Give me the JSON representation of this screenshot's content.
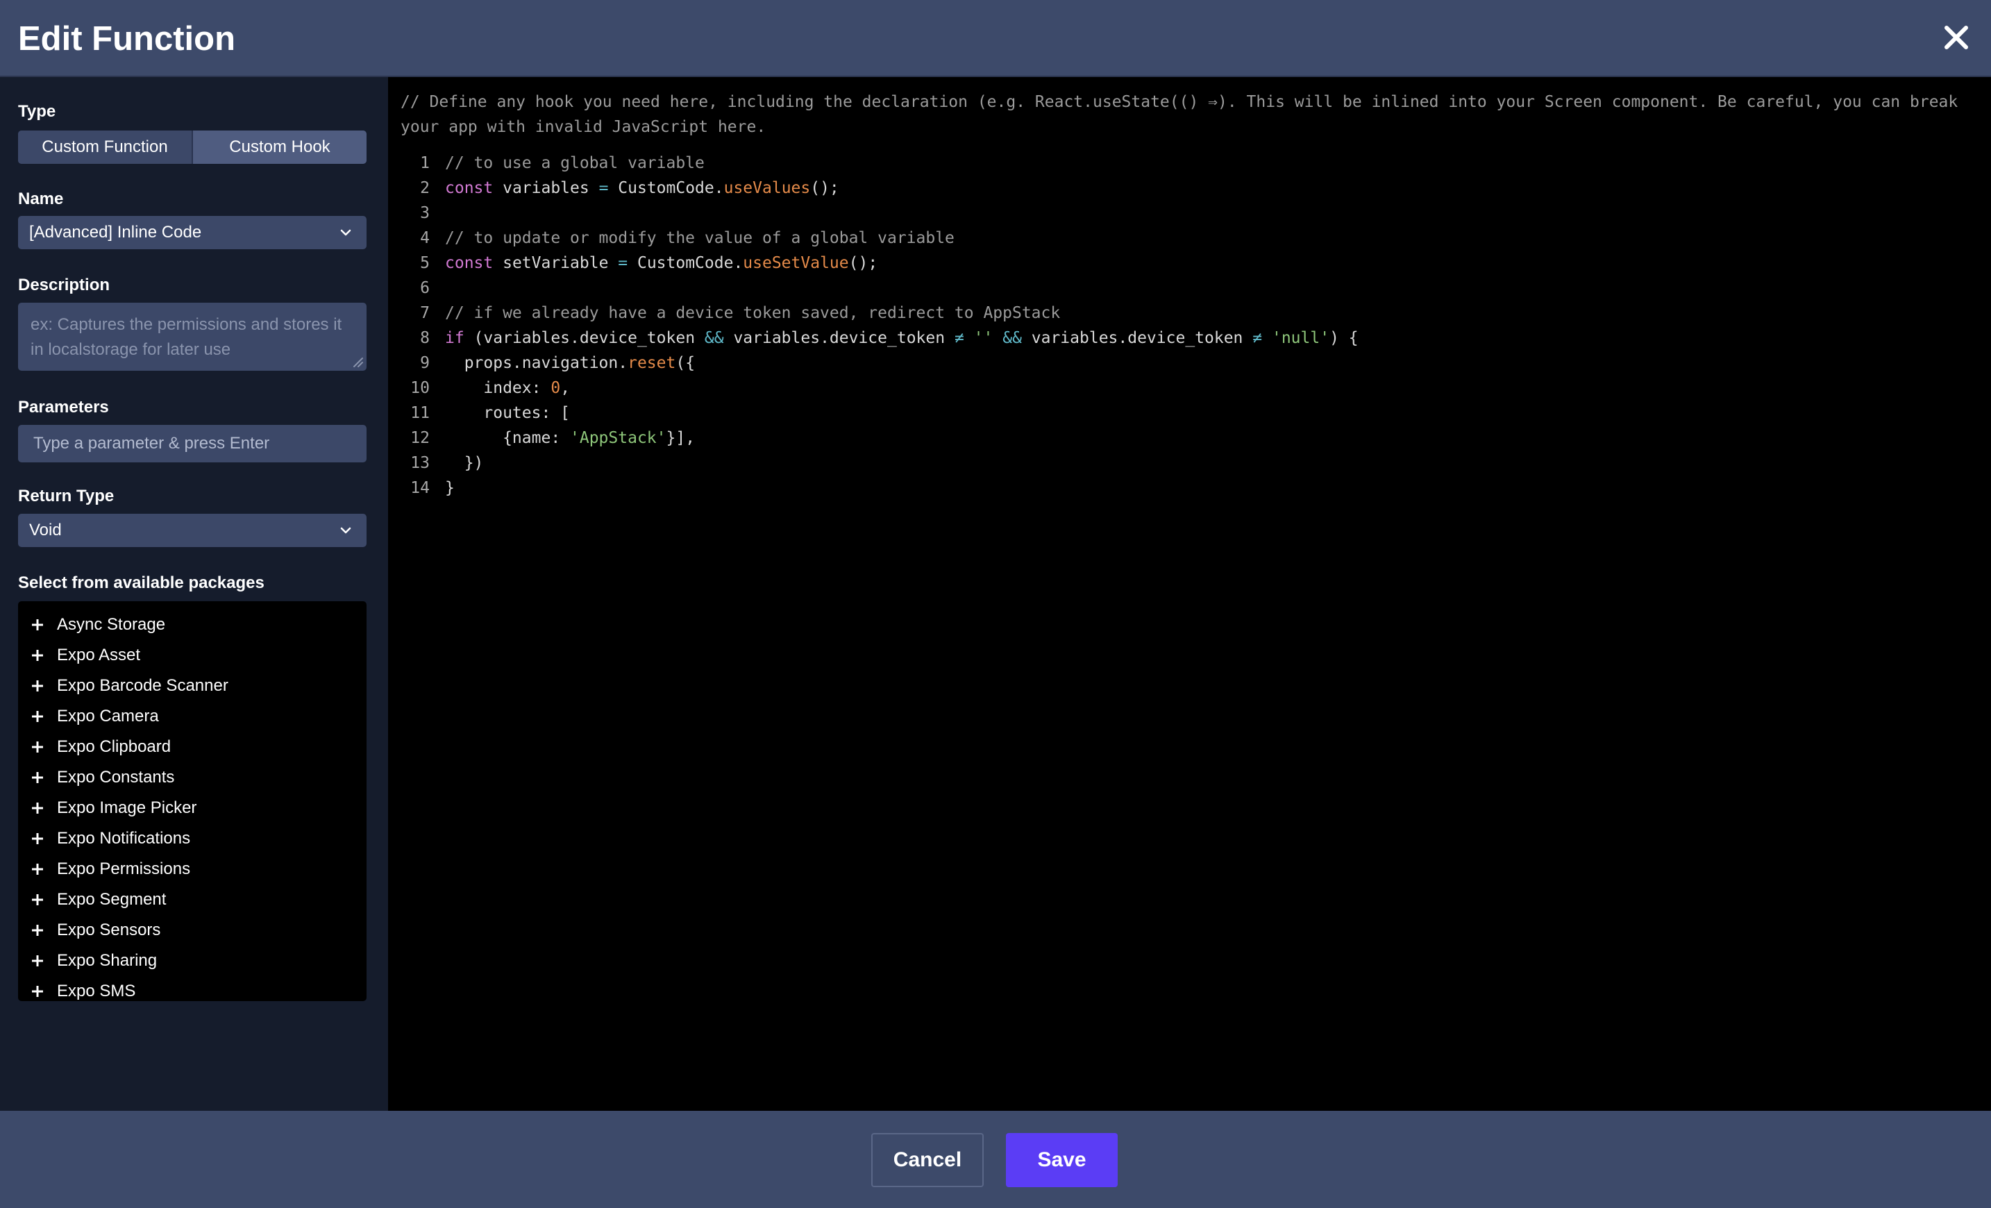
{
  "header": {
    "title": "Edit Function",
    "close_icon": "close-icon"
  },
  "left": {
    "type": {
      "label": "Type",
      "options": [
        "Custom Function",
        "Custom Hook"
      ],
      "selected": "Custom Hook"
    },
    "name": {
      "label": "Name",
      "value": "[Advanced] Inline Code"
    },
    "description": {
      "label": "Description",
      "placeholder": "ex: Captures the permissions and stores it in localstorage for later use"
    },
    "parameters": {
      "label": "Parameters",
      "placeholder": "Type a parameter & press Enter"
    },
    "return_type": {
      "label": "Return Type",
      "value": "Void"
    },
    "packages": {
      "label": "Select from available packages",
      "items": [
        "Async Storage",
        "Expo Asset",
        "Expo Barcode Scanner",
        "Expo Camera",
        "Expo Clipboard",
        "Expo Constants",
        "Expo Image Picker",
        "Expo Notifications",
        "Expo Permissions",
        "Expo Segment",
        "Expo Sensors",
        "Expo Sharing",
        "Expo SMS"
      ]
    }
  },
  "editor": {
    "hint": "// Define any hook you need here, including the declaration (e.g. React.useState(() ⇒). This will be inlined into your Screen component. Be careful, you can break your app with invalid JavaScript here.",
    "line_numbers": [
      "1",
      "2",
      "3",
      "4",
      "5",
      "6",
      "7",
      "8",
      "9",
      "10",
      "11",
      "12",
      "13",
      "14"
    ],
    "lines": [
      "// to use a global variable",
      "const variables = CustomCode.useValues();",
      "",
      "// to update or modify the value of a global variable",
      "const setVariable = CustomCode.useSetValue();",
      "",
      "// if we already have a device token saved, redirect to AppStack",
      "if (variables.device_token && variables.device_token ≠ '' && variables.device_token ≠ 'null') {",
      "  props.navigation.reset({",
      "    index: 0,",
      "    routes: [",
      "      {name: 'AppStack'}],",
      "  })",
      "}"
    ]
  },
  "footer": {
    "cancel_label": "Cancel",
    "save_label": "Save"
  },
  "colors": {
    "accent": "#5b3df5",
    "panel": "#3c4868",
    "header": "#3d4a6a"
  }
}
